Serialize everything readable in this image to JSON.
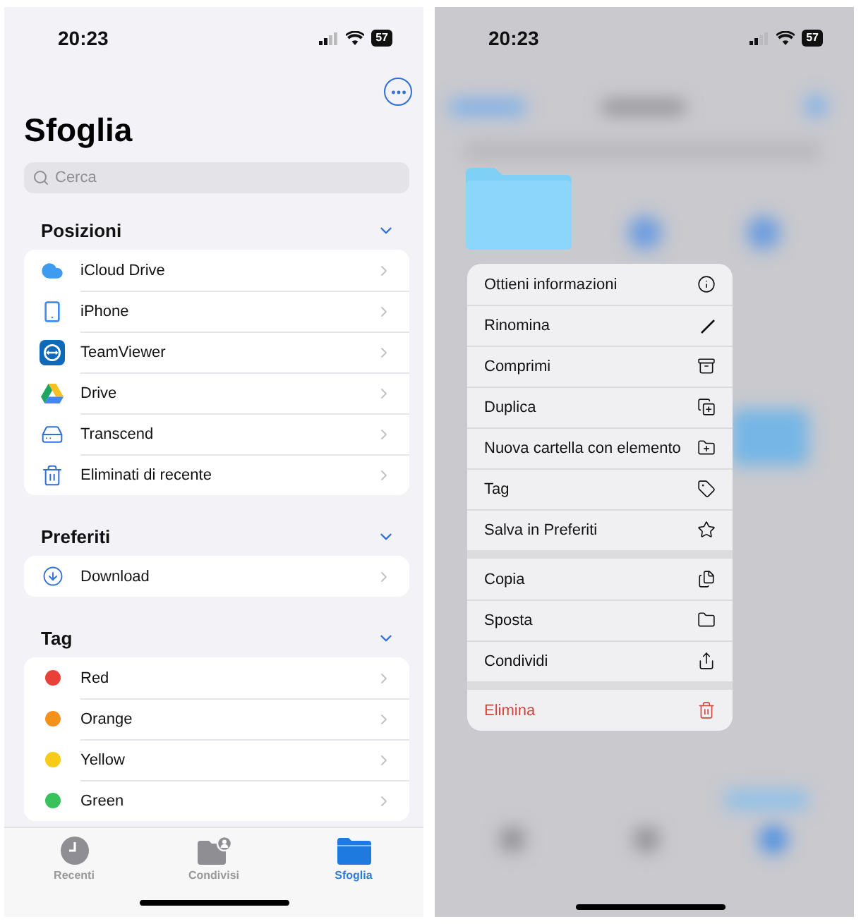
{
  "browse_screen": {
    "status_bar": {
      "time": "20:23",
      "battery": "57"
    },
    "title": "Sfoglia",
    "search": {
      "placeholder": "Cerca"
    },
    "sections": [
      {
        "kind": "locations",
        "title": "Posizioni",
        "expanded": true,
        "items": [
          {
            "label": "iCloud Drive"
          },
          {
            "label": "iPhone"
          },
          {
            "label": "TeamViewer"
          },
          {
            "label": "Drive"
          },
          {
            "label": "Transcend"
          },
          {
            "label": "Eliminati di recente"
          }
        ]
      },
      {
        "kind": "favorites",
        "title": "Preferiti",
        "expanded": true,
        "items": [
          {
            "label": "Download"
          }
        ]
      },
      {
        "kind": "tags",
        "title": "Tag",
        "expanded": true,
        "items": [
          {
            "label": "Red",
            "color": "#e9403a"
          },
          {
            "label": "Orange",
            "color": "#f4901c"
          },
          {
            "label": "Yellow",
            "color": "#f7cb17"
          },
          {
            "label": "Green",
            "color": "#38c25a"
          }
        ]
      }
    ],
    "tab_bar": [
      {
        "label": "Recenti",
        "selected": false
      },
      {
        "label": "Condivisi",
        "selected": false
      },
      {
        "label": "Sfoglia",
        "selected": true
      }
    ]
  },
  "menu_screen": {
    "status_bar": {
      "time": "20:23",
      "battery": "57"
    },
    "context_menu": [
      [
        {
          "label": "Ottieni informazioni",
          "destructive": false
        },
        {
          "label": "Rinomina",
          "destructive": false
        },
        {
          "label": "Comprimi",
          "destructive": false
        },
        {
          "label": "Duplica",
          "destructive": false
        },
        {
          "label": "Nuova cartella con elemento",
          "destructive": false
        },
        {
          "label": "Tag",
          "destructive": false
        },
        {
          "label": "Salva in Preferiti",
          "destructive": false
        }
      ],
      [
        {
          "label": "Copia",
          "destructive": false
        },
        {
          "label": "Sposta",
          "destructive": false
        },
        {
          "label": "Condividi",
          "destructive": false
        }
      ],
      [
        {
          "label": "Elimina",
          "destructive": true
        }
      ]
    ]
  }
}
